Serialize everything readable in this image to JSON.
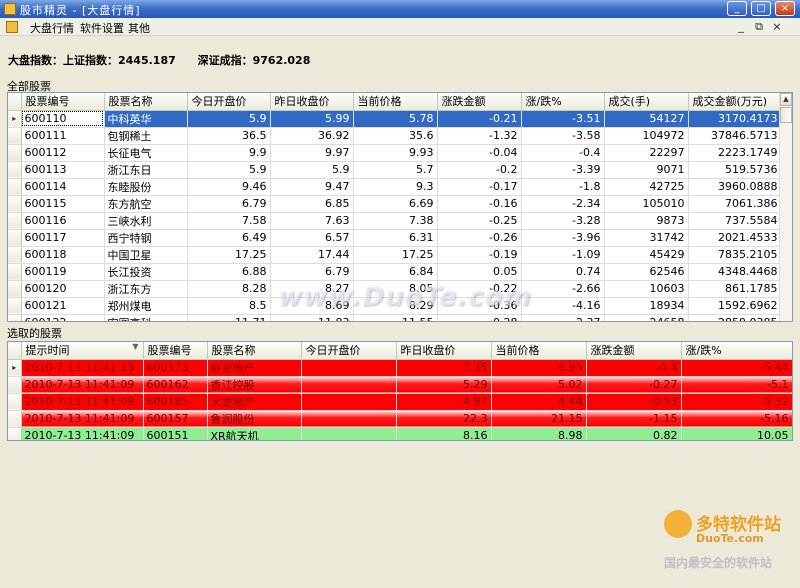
{
  "window": {
    "title": "股市精灵 - [大盘行情]",
    "controls": [
      "_",
      "□",
      "×"
    ]
  },
  "menu": {
    "items": [
      "大盘行情",
      "软件设置",
      "其他"
    ],
    "mdi_controls": [
      "_",
      "⧉",
      "×"
    ]
  },
  "index": {
    "shanghai": "大盘指数：上证指数：2445.187",
    "shenzhen": "深证成指：9762.028"
  },
  "all_stocks": {
    "label": "全部股票",
    "columns": [
      "股票编号",
      "股票名称",
      "今日开盘价",
      "昨日收盘价",
      "当前价格",
      "涨跌金额",
      "涨/跌%",
      "成交(手)",
      "成交金额(万元)"
    ],
    "rows": [
      [
        "600110",
        "中科英华",
        "5.9",
        "5.99",
        "5.78",
        "-0.21",
        "-3.51",
        "54127",
        "3170.4173"
      ],
      [
        "600111",
        "包钢稀土",
        "36.5",
        "36.92",
        "35.6",
        "-1.32",
        "-3.58",
        "104972",
        "37846.5713"
      ],
      [
        "600112",
        "长征电气",
        "9.9",
        "9.97",
        "9.93",
        "-0.04",
        "-0.4",
        "22297",
        "2223.1749"
      ],
      [
        "600113",
        "浙江东日",
        "5.9",
        "5.9",
        "5.7",
        "-0.2",
        "-3.39",
        "9071",
        "519.5736"
      ],
      [
        "600114",
        "东睦股份",
        "9.46",
        "9.47",
        "9.3",
        "-0.17",
        "-1.8",
        "42725",
        "3960.0888"
      ],
      [
        "600115",
        "东方航空",
        "6.79",
        "6.85",
        "6.69",
        "-0.16",
        "-2.34",
        "105010",
        "7061.386"
      ],
      [
        "600116",
        "三峡水利",
        "7.58",
        "7.63",
        "7.38",
        "-0.25",
        "-3.28",
        "9873",
        "737.5584"
      ],
      [
        "600117",
        "西宁特钢",
        "6.49",
        "6.57",
        "6.31",
        "-0.26",
        "-3.96",
        "31742",
        "2021.4533"
      ],
      [
        "600118",
        "中国卫星",
        "17.25",
        "17.44",
        "17.25",
        "-0.19",
        "-1.09",
        "45429",
        "7835.2105"
      ],
      [
        "600119",
        "长江投资",
        "6.88",
        "6.79",
        "6.84",
        "0.05",
        "0.74",
        "62546",
        "4348.4468"
      ],
      [
        "600120",
        "浙江东方",
        "8.28",
        "8.27",
        "8.05",
        "-0.22",
        "-2.66",
        "10603",
        "861.1785"
      ],
      [
        "600121",
        "郑州煤电",
        "8.5",
        "8.69",
        "8.29",
        "-0.36",
        "-4.16",
        "18934",
        "1592.6962"
      ],
      [
        "600122",
        "宏图高科",
        "11.71",
        "11.83",
        "11.55",
        "-0.28",
        "-2.37",
        "24658",
        "2859.0385"
      ]
    ]
  },
  "selected_stocks": {
    "label": "选取的股票",
    "columns": [
      "提示时间",
      "股票编号",
      "股票名称",
      "今日开盘价",
      "昨日收盘价",
      "当前价格",
      "涨跌金额",
      "涨/跌%"
    ],
    "rows": [
      [
        "2010-7-13 11:41:15",
        "600173",
        "卧龙地产",
        "",
        "7.35",
        "6.95",
        "-0.4",
        "-5.44"
      ],
      [
        "2010-7-13 11:41:09",
        "600162",
        "香江控股",
        "",
        "5.29",
        "5.02",
        "-0.27",
        "-5.1"
      ],
      [
        "2010-7-13 11:41:09",
        "600185",
        "大龙地产",
        "",
        "4.97",
        "4.44",
        "-0.53",
        "-5.32"
      ],
      [
        "2010-7-13 11:41:09",
        "600157",
        "鲁润股份",
        "",
        "22.3",
        "21.15",
        "-1.15",
        "-5.16"
      ],
      [
        "2010-7-13 11:41:09",
        "600151",
        "XR航天机",
        "",
        "8.16",
        "8.98",
        "0.82",
        "10.05"
      ]
    ]
  },
  "watermark": "www.DuoTe.com",
  "logo": {
    "brand": "多特软件站",
    "sub": "DuoTe.com",
    "slogan": "国内最安全的软件站"
  },
  "colors": {
    "down": "#ff0000",
    "up": "#90ee90",
    "selection": "#316ac5"
  }
}
